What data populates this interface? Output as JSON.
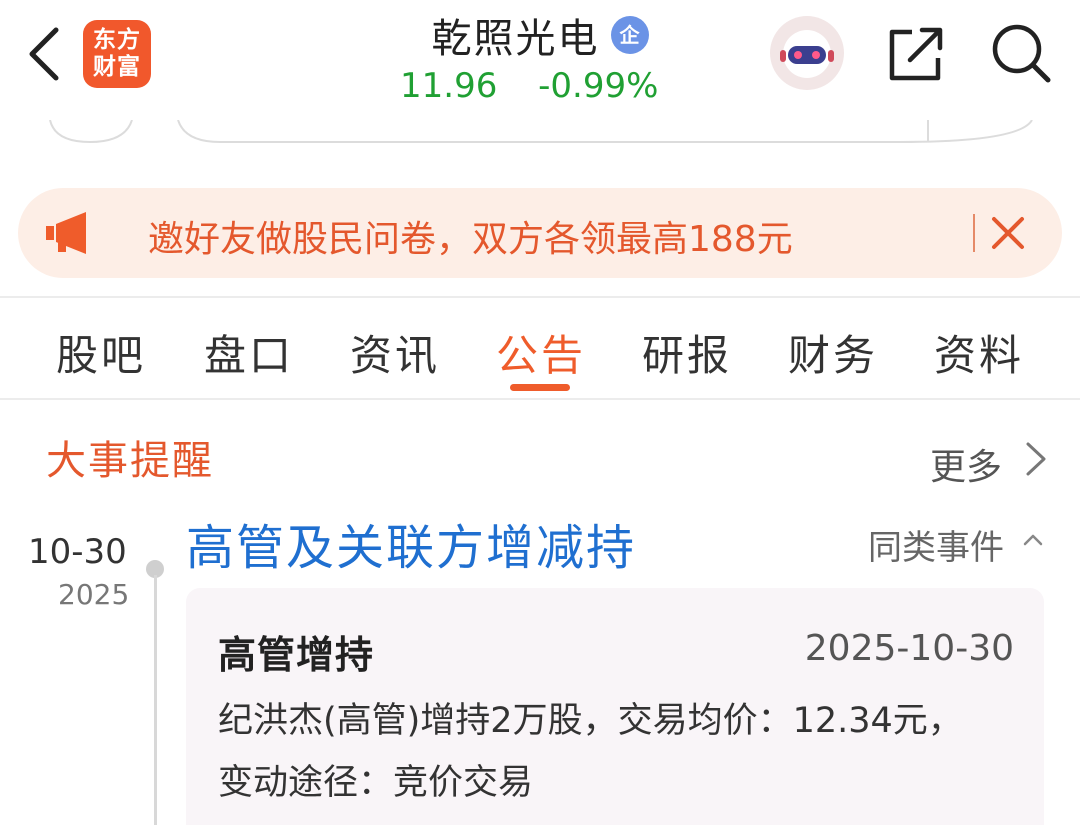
{
  "header": {
    "logo_line1": "东方",
    "logo_line2": "财富",
    "stock_name": "乾照光电",
    "enterprise_badge": "企",
    "price": "11.96",
    "change_pct": "-0.99%",
    "price_color": "#20a033"
  },
  "notice": {
    "text": "邀好友做股民问卷，双方各领最高188元",
    "color": "#e4582d"
  },
  "tabs": [
    {
      "label": "股吧"
    },
    {
      "label": "盘口"
    },
    {
      "label": "资讯"
    },
    {
      "label": "公告",
      "active": true
    },
    {
      "label": "研报"
    },
    {
      "label": "财务"
    },
    {
      "label": "资料"
    }
  ],
  "events": {
    "section_title": "大事提醒",
    "more_label": "更多",
    "date_main": "10-30",
    "date_year": "2025",
    "event_title": "高管及关联方增减持",
    "similar_label": "同类事件",
    "card": {
      "title": "高管增持",
      "date": "2025-10-30",
      "line1": "纪洪杰(高管)增持2万股，交易均价：12.34元，",
      "line2": "变动途径：竞价交易"
    }
  },
  "icons": [
    "back-arrow-icon",
    "robot-avatar-icon",
    "share-icon",
    "search-icon",
    "megaphone-icon",
    "close-icon",
    "chevron-right-icon",
    "chevron-up-icon"
  ],
  "colors": {
    "accent": "#ef5c2b",
    "link_blue": "#1f6fd0",
    "notice_bg": "#fdeee6"
  }
}
